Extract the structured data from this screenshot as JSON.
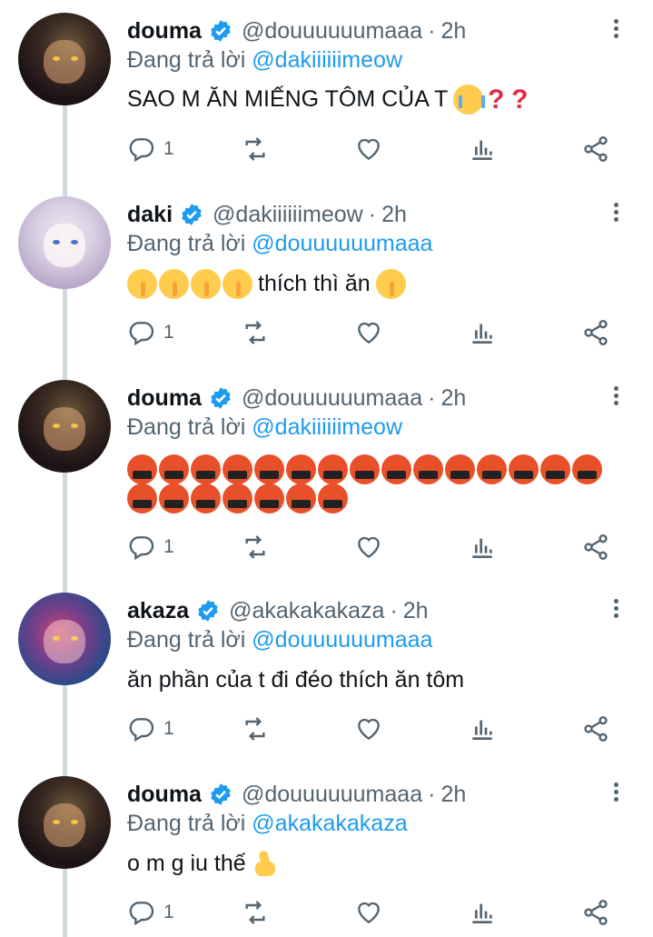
{
  "tweets": [
    {
      "avatar": "douma-avatar",
      "name": "douma",
      "handle": "@douuuuuumaaa",
      "time": "2h",
      "reply_prefix": "Đang trả lời",
      "reply_to": "@dakiiiiiimeow",
      "text": "SAO M ĂN MIẾNG TÔM CỦA T",
      "text_emojis": [
        "loudly-crying-face",
        "red-question-mark",
        "red-question-mark"
      ],
      "reply_count": "1"
    },
    {
      "avatar": "daki-avatar",
      "name": "daki",
      "handle": "@dakiiiiiimeow",
      "time": "2h",
      "reply_prefix": "Đang trả lời",
      "reply_to": "@douuuuuumaaa",
      "text": "thích thì ăn",
      "text_emojis": [
        "shushing-face",
        "shushing-face",
        "shushing-face",
        "shushing-face",
        "shushing-face"
      ],
      "reply_count": "1"
    },
    {
      "avatar": "douma-avatar",
      "name": "douma",
      "handle": "@douuuuuumaaa",
      "time": "2h",
      "reply_prefix": "Đang trả lời",
      "reply_to": "@dakiiiiiimeow",
      "text": "",
      "text_emojis": [
        "face-with-symbols-on-mouth"
      ],
      "emoji_count": 22,
      "reply_count": "1"
    },
    {
      "avatar": "akaza-avatar",
      "name": "akaza",
      "handle": "@akakakakaza",
      "time": "2h",
      "reply_prefix": "Đang trả lời",
      "reply_to": "@douuuuuumaaa",
      "text": "ăn phần của t đi đéo thích ăn tôm",
      "text_emojis": [],
      "reply_count": "1"
    },
    {
      "avatar": "douma-avatar",
      "name": "douma",
      "handle": "@douuuuuumaaa",
      "time": "2h",
      "reply_prefix": "Đang trả lời",
      "reply_to": "@akakakakaza",
      "text": "o m g iu thế",
      "text_emojis": [
        "crossed-fingers"
      ],
      "reply_count": "1"
    }
  ],
  "dot_separator": "·",
  "colors": {
    "link": "#1d9bf0",
    "secondary": "#536471",
    "thread_line": "#cfd9de",
    "verified": "#1d9bf0"
  }
}
